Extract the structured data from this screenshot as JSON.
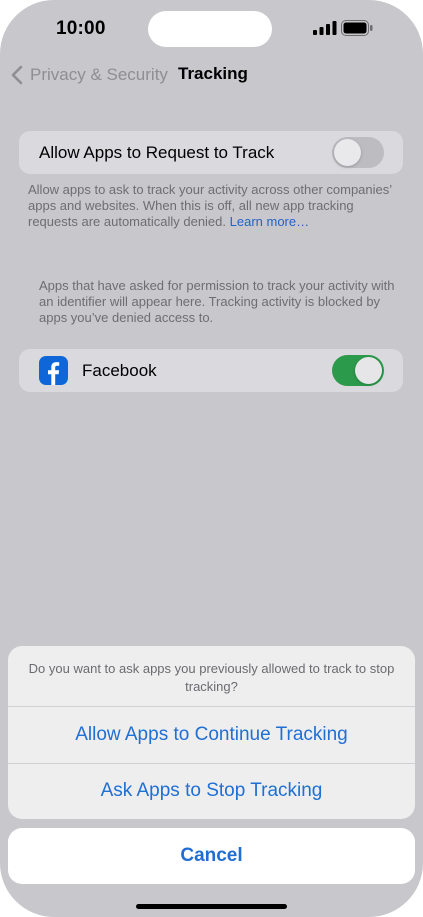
{
  "status_bar": {
    "time": "10:00",
    "signal_icon": "cellular-signal-icon",
    "battery_icon": "battery-icon"
  },
  "nav": {
    "back_label": "Privacy & Security",
    "back_icon": "chevron-left-icon",
    "title": "Tracking"
  },
  "allow_tracking": {
    "label": "Allow Apps to Request to Track",
    "enabled": false,
    "footer_text": "Allow apps to ask to track your activity across other companies’ apps and websites. When this is off, all new app tracking requests are automatically denied.",
    "footer_link": "Learn more…"
  },
  "apps_section": {
    "header_text": "Apps that have asked for permission to track your activity with an identifier will appear here. Tracking activity is blocked by apps you’ve denied access to.",
    "apps": [
      {
        "name": "Facebook",
        "icon": "facebook-icon",
        "enabled": true
      }
    ]
  },
  "action_sheet": {
    "message": "Do you want to ask apps you previously allowed to track to stop tracking?",
    "actions": [
      {
        "label": "Allow Apps to Continue Tracking"
      },
      {
        "label": "Ask Apps to Stop Tracking"
      }
    ],
    "cancel_label": "Cancel"
  },
  "colors": {
    "accent": "#1f6fd4",
    "toggle_on": "#2c9a4b",
    "toggle_off": "#bcbcc1",
    "facebook_blue": "#0f66d9",
    "dim_background": "#c7c7cc"
  }
}
